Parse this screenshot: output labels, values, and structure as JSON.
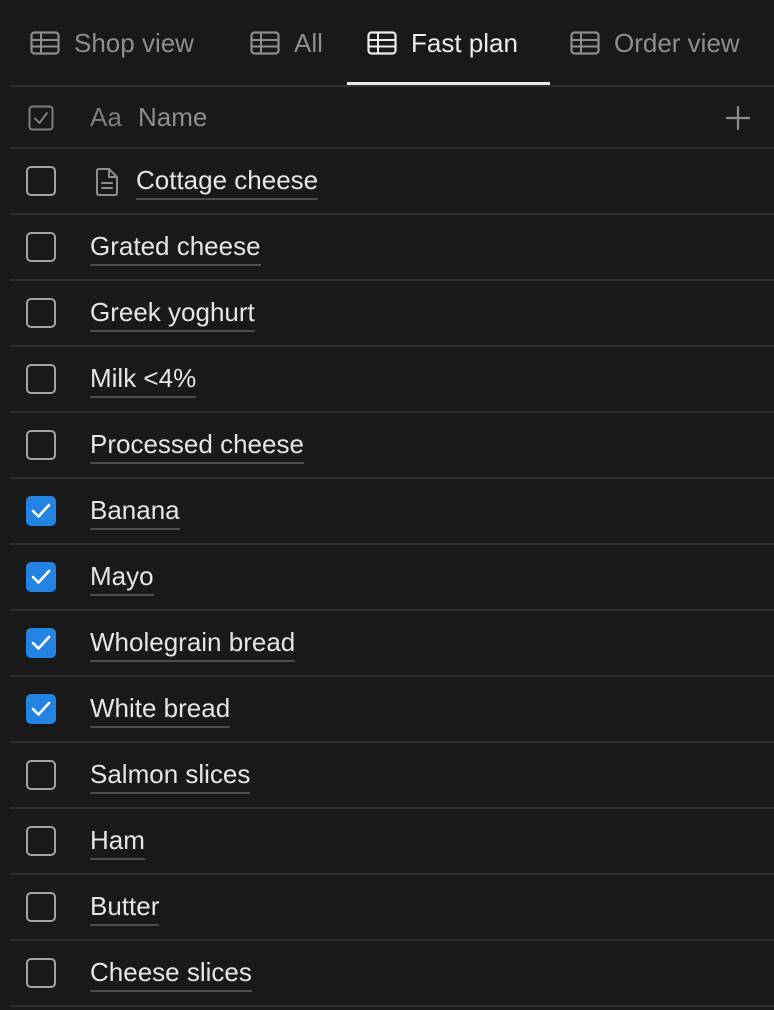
{
  "tabs": [
    {
      "label": "Shop view",
      "active": false,
      "icon": "table-icon"
    },
    {
      "label": "All",
      "active": false,
      "icon": "table-icon"
    },
    {
      "label": "Fast plan",
      "active": true,
      "icon": "table-icon"
    },
    {
      "label": "Order view",
      "active": false,
      "icon": "table-icon"
    }
  ],
  "header": {
    "checkbox_icon": "checkbox-property-icon",
    "name_type_icon": "Aa",
    "name_label": "Name",
    "add_icon": "plus-icon"
  },
  "rows": [
    {
      "name": "Cottage cheese",
      "checked": false,
      "has_page_icon": true
    },
    {
      "name": "Grated cheese",
      "checked": false
    },
    {
      "name": "Greek yoghurt",
      "checked": false
    },
    {
      "name": "Milk <4%",
      "checked": false
    },
    {
      "name": "Processed cheese",
      "checked": false
    },
    {
      "name": "Banana",
      "checked": true
    },
    {
      "name": "Mayo",
      "checked": true
    },
    {
      "name": "Wholegrain bread",
      "checked": true
    },
    {
      "name": "White bread",
      "checked": true
    },
    {
      "name": "Salmon slices",
      "checked": false
    },
    {
      "name": "Ham",
      "checked": false
    },
    {
      "name": "Butter",
      "checked": false
    },
    {
      "name": "Cheese slices",
      "checked": false
    }
  ],
  "colors": {
    "background": "#191919",
    "checked_accent": "#2383e2",
    "divider": "#2f2f2f"
  }
}
